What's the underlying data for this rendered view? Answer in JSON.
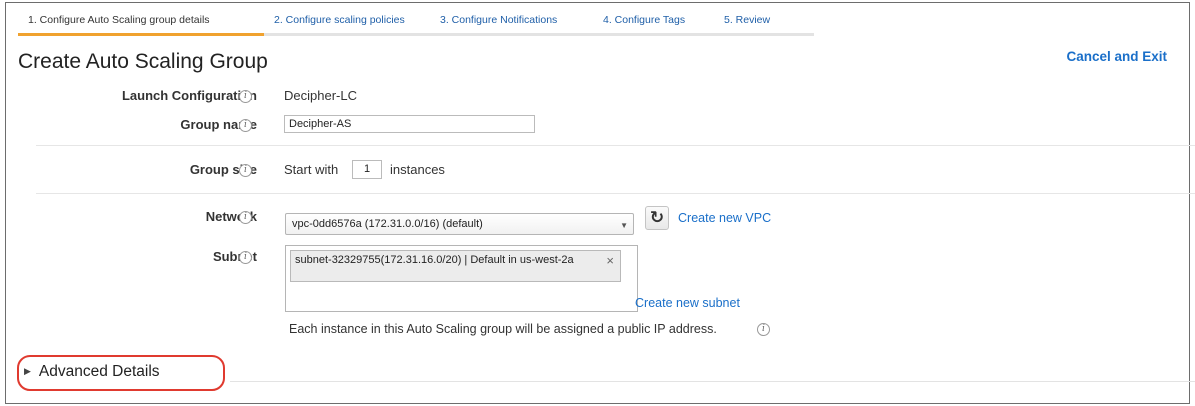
{
  "tabs": [
    {
      "label": "1. Configure Auto Scaling group details",
      "active": true
    },
    {
      "label": "2. Configure scaling policies",
      "active": false
    },
    {
      "label": "3. Configure Notifications",
      "active": false
    },
    {
      "label": "4. Configure Tags",
      "active": false
    },
    {
      "label": "5. Review",
      "active": false
    }
  ],
  "page": {
    "title": "Create Auto Scaling Group",
    "cancel_label": "Cancel and Exit"
  },
  "form": {
    "launch_config": {
      "label": "Launch Configuration",
      "value": "Decipher-LC"
    },
    "group_name": {
      "label": "Group name",
      "value": "Decipher-AS"
    },
    "group_size": {
      "label": "Group size",
      "prefix": "Start with",
      "value": "1",
      "suffix": "instances"
    },
    "network": {
      "label": "Network",
      "selected": "vpc-0dd6576a (172.31.0.0/16) (default)",
      "create_link": "Create new VPC"
    },
    "subnet": {
      "label": "Subnet",
      "chip_text": "subnet-32329755(172.31.16.0/20) | Default in us-west-2a",
      "create_link": "Create new subnet"
    },
    "public_ip_note": "Each instance in this Auto Scaling group will be assigned a public IP address."
  },
  "advanced": {
    "label": "Advanced Details"
  },
  "colors": {
    "link": "#1a6fc9",
    "active_tab_underline": "#f0a22f",
    "highlight_circle": "#e03a2f"
  }
}
